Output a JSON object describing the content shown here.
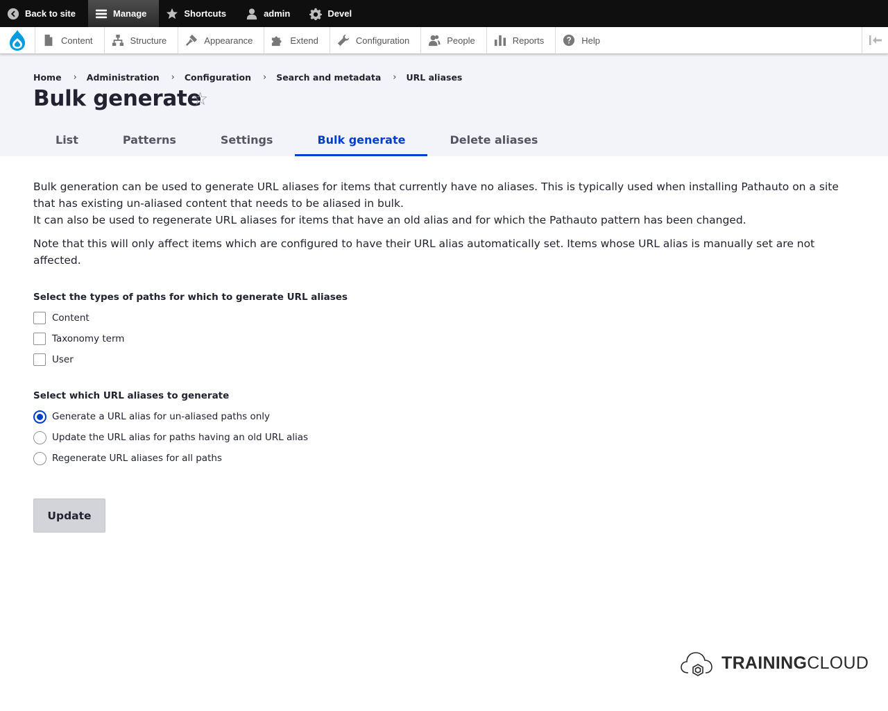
{
  "toolbar": {
    "items": [
      {
        "label": "Back to site",
        "icon": "back-arrow-icon"
      },
      {
        "label": "Manage",
        "icon": "hamburger-icon",
        "active": true
      },
      {
        "label": "Shortcuts",
        "icon": "star-icon"
      },
      {
        "label": "admin",
        "icon": "user-icon"
      },
      {
        "label": "Devel",
        "icon": "gear-icon"
      }
    ]
  },
  "tray": {
    "logo_icon": "drupal-drop-icon",
    "items": [
      {
        "label": "Content",
        "icon": "document-icon"
      },
      {
        "label": "Structure",
        "icon": "structure-icon"
      },
      {
        "label": "Appearance",
        "icon": "paintbrush-icon"
      },
      {
        "label": "Extend",
        "icon": "puzzle-icon"
      },
      {
        "label": "Configuration",
        "icon": "wrench-icon"
      },
      {
        "label": "People",
        "icon": "people-icon"
      },
      {
        "label": "Reports",
        "icon": "bar-chart-icon"
      },
      {
        "label": "Help",
        "icon": "help-icon"
      }
    ],
    "orientation_toggle_icon": "collapse-left-icon"
  },
  "breadcrumb": [
    "Home",
    "Administration",
    "Configuration",
    "Search and metadata",
    "URL aliases"
  ],
  "page": {
    "title": "Bulk generate",
    "star_glyph": "☆"
  },
  "tabs": [
    {
      "label": "List",
      "active": false
    },
    {
      "label": "Patterns",
      "active": false
    },
    {
      "label": "Settings",
      "active": false
    },
    {
      "label": "Bulk generate",
      "active": true
    },
    {
      "label": "Delete aliases",
      "active": false
    }
  ],
  "description": {
    "p1": "Bulk generation can be used to generate URL aliases for items that currently have no aliases. This is typically used when installing Pathauto on a site that has existing un-aliased content that needs to be aliased in bulk.",
    "p2": "It can also be used to regenerate URL aliases for items that have an old alias and for which the Pathauto pattern has been changed.",
    "note": "Note that this will only affect items which are configured to have their URL alias automatically set. Items whose URL alias is manually set are not affected."
  },
  "path_types": {
    "label": "Select the types of paths for which to generate URL aliases",
    "options": [
      {
        "label": "Content",
        "checked": false
      },
      {
        "label": "Taxonomy term",
        "checked": false
      },
      {
        "label": "User",
        "checked": false
      }
    ]
  },
  "alias_action": {
    "label": "Select which URL aliases to generate",
    "options": [
      {
        "label": "Generate a URL alias for un-aliased paths only",
        "checked": true
      },
      {
        "label": "Update the URL alias for paths having an old URL alias",
        "checked": false
      },
      {
        "label": "Regenerate URL aliases for all paths",
        "checked": false
      }
    ]
  },
  "submit_label": "Update",
  "watermark": {
    "bold": "TRAINING",
    "light": "CLOUD",
    "icon": "cloud-logo-icon"
  },
  "colors": {
    "accent": "#003ecc",
    "toolbar_bg": "#0f0f0f",
    "header_bg": "#f3f4f9"
  }
}
